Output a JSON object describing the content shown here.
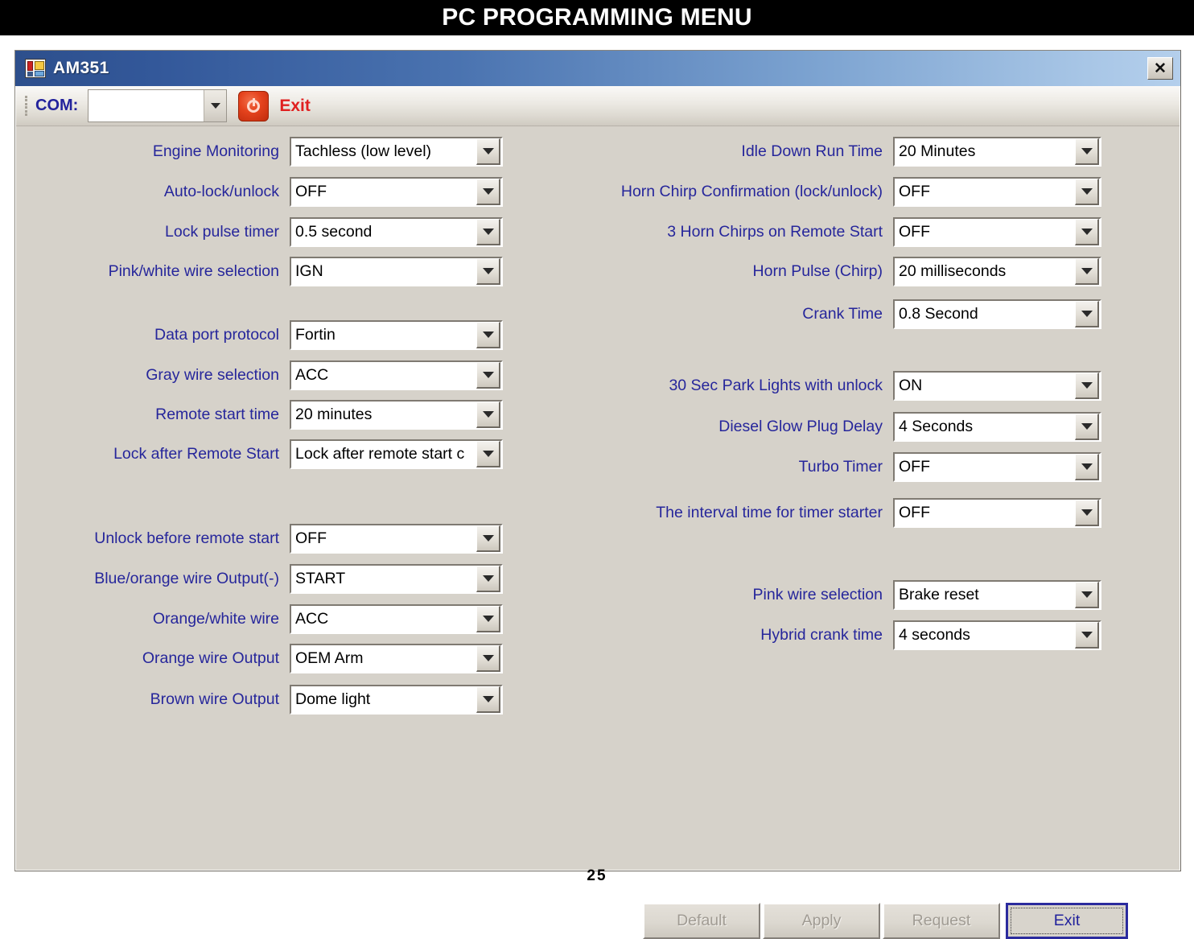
{
  "document": {
    "header_title": "PC PROGRAMMING MENU",
    "page_number": "25"
  },
  "window": {
    "title": "AM351",
    "close_label": "✕"
  },
  "toolbar": {
    "com_label": "COM:",
    "com_value": "",
    "exit_label": "Exit"
  },
  "left_column": {
    "groups": [
      {
        "rows": [
          {
            "label": "Engine Monitoring",
            "value": "Tachless (low level)"
          },
          {
            "label": "Auto-lock/unlock",
            "value": "OFF"
          },
          {
            "label": "Lock pulse timer",
            "value": "0.5 second"
          },
          {
            "label": "Pink/white wire selection",
            "value": "IGN"
          }
        ]
      },
      {
        "rows": [
          {
            "label": "Data port protocol",
            "value": "Fortin"
          },
          {
            "label": "Gray wire selection",
            "value": "ACC"
          },
          {
            "label": "Remote start time",
            "value": "20 minutes"
          },
          {
            "label": "Lock after Remote Start",
            "value": "Lock after remote start c"
          }
        ]
      },
      {
        "rows": [
          {
            "label": "Unlock before remote start",
            "value": "OFF"
          },
          {
            "label": "Blue/orange wire Output(-)",
            "value": "START"
          },
          {
            "label": "Orange/white wire",
            "value": "ACC"
          },
          {
            "label": "Orange wire Output",
            "value": "OEM Arm"
          },
          {
            "label": "Brown wire Output",
            "value": "Dome light"
          }
        ]
      }
    ]
  },
  "right_column": {
    "groups": [
      {
        "rows": [
          {
            "label": "Idle Down Run Time",
            "value": "20 Minutes"
          },
          {
            "label": "Horn Chirp Confirmation (lock/unlock)",
            "value": "OFF"
          },
          {
            "label": "3 Horn Chirps on Remote Start",
            "value": "OFF"
          },
          {
            "label": "Horn Pulse (Chirp)",
            "value": "20 milliseconds"
          },
          {
            "label": "Crank Time",
            "value": "0.8 Second"
          }
        ]
      },
      {
        "rows": [
          {
            "label": "30 Sec Park Lights with unlock",
            "value": "ON"
          },
          {
            "label": "Diesel Glow Plug Delay",
            "value": "4 Seconds"
          },
          {
            "label": "Turbo Timer",
            "value": "OFF"
          },
          {
            "label": "The interval time for timer starter",
            "value": "OFF"
          }
        ]
      },
      {
        "rows": [
          {
            "label": "Pink wire selection",
            "value": "Brake reset"
          },
          {
            "label": "Hybrid crank time",
            "value": "4 seconds"
          }
        ]
      }
    ]
  },
  "buttons": [
    {
      "label": "Default",
      "state": "disabled"
    },
    {
      "label": "Apply",
      "state": "disabled"
    },
    {
      "label": "Request",
      "state": "disabled"
    },
    {
      "label": "Exit",
      "state": "focused"
    }
  ],
  "colors": {
    "label_blue": "#26269b",
    "form_background": "#d6d2ca",
    "titlebar_dark": "#2d4f8c",
    "titlebar_light": "#b4cfec",
    "exit_red": "#e02020",
    "header_background": "#000000"
  }
}
